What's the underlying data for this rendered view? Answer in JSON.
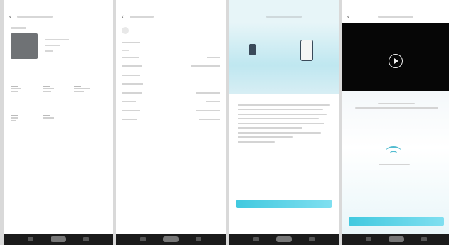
{
  "panels": [
    {
      "status_time": "",
      "status_right": ""
    },
    {
      "status_time": "",
      "status_right": ""
    },
    {
      "status_time": "",
      "status_right": ""
    },
    {
      "status_time": "",
      "status_right": ""
    }
  ],
  "colors": {
    "accent": "#41c9df",
    "navbar": "#1b1b1b",
    "video_background": "#060606",
    "thumbnail": "#6f7275"
  }
}
